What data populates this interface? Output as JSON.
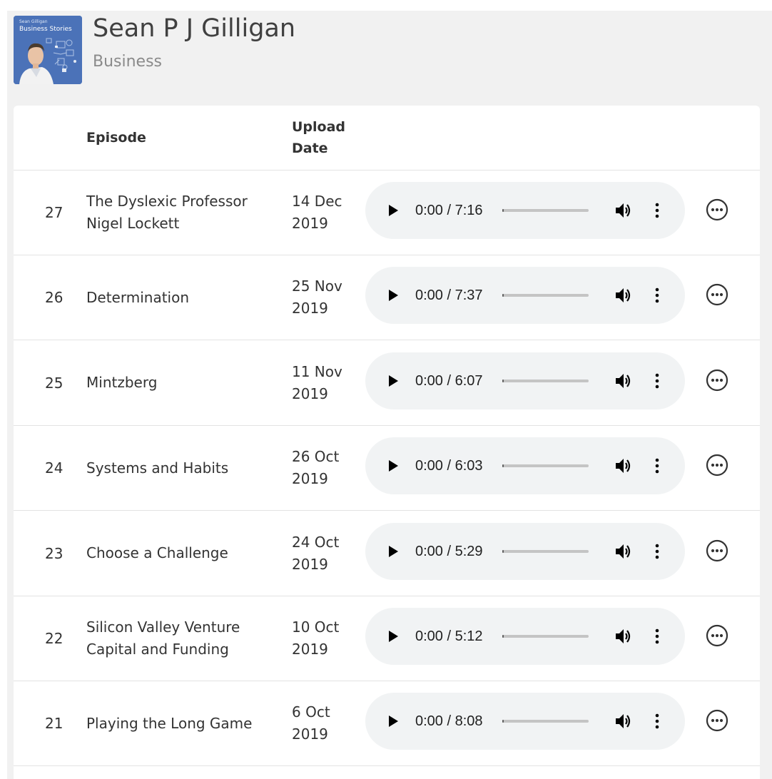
{
  "podcast": {
    "title": "Sean P J Gilligan",
    "category": "Business",
    "cover": {
      "line1": "Sean Gilligan",
      "line2": "Business Stories",
      "bg_color": "#4b72b8"
    }
  },
  "table": {
    "headers": {
      "number": "",
      "episode": "Episode",
      "upload_date": "Upload Date"
    },
    "rows": [
      {
        "number": "27",
        "title": "The Dyslexic Professor Nigel Lockett",
        "date": "14 Dec 2019",
        "time": "0:00 / 7:16",
        "progress": 0.0
      },
      {
        "number": "26",
        "title": "Determination",
        "date": "25 Nov 2019",
        "time": "0:00 / 7:37",
        "progress": 0.0
      },
      {
        "number": "25",
        "title": "Mintzberg",
        "date": "11 Nov 2019",
        "time": "0:00 / 6:07",
        "progress": 0.0
      },
      {
        "number": "24",
        "title": "Systems and Habits",
        "date": "26 Oct 2019",
        "time": "0:00 / 6:03",
        "progress": 0.0
      },
      {
        "number": "23",
        "title": "Choose a Challenge",
        "date": "24 Oct 2019",
        "time": "0:00 / 5:29",
        "progress": 0.0
      },
      {
        "number": "22",
        "title": "Silicon Valley Venture Capital and Funding",
        "date": "10 Oct 2019",
        "time": "0:00 / 5:12",
        "progress": 0.0
      },
      {
        "number": "21",
        "title": "Playing the Long Game",
        "date": "6 Oct 2019",
        "time": "0:00 / 8:08",
        "progress": 0.0
      }
    ]
  },
  "icons": {
    "play": "play-icon",
    "volume": "volume-icon",
    "player_menu": "kebab-menu-icon",
    "row_menu": "more-options-icon"
  },
  "colors": {
    "page_bg": "#f1f1f1",
    "card_bg": "#ffffff",
    "player_bg": "#f1f3f4",
    "track": "#c4c4c4",
    "divider": "#e3e3e3",
    "text": "#333333",
    "muted": "#8a8a8a"
  }
}
